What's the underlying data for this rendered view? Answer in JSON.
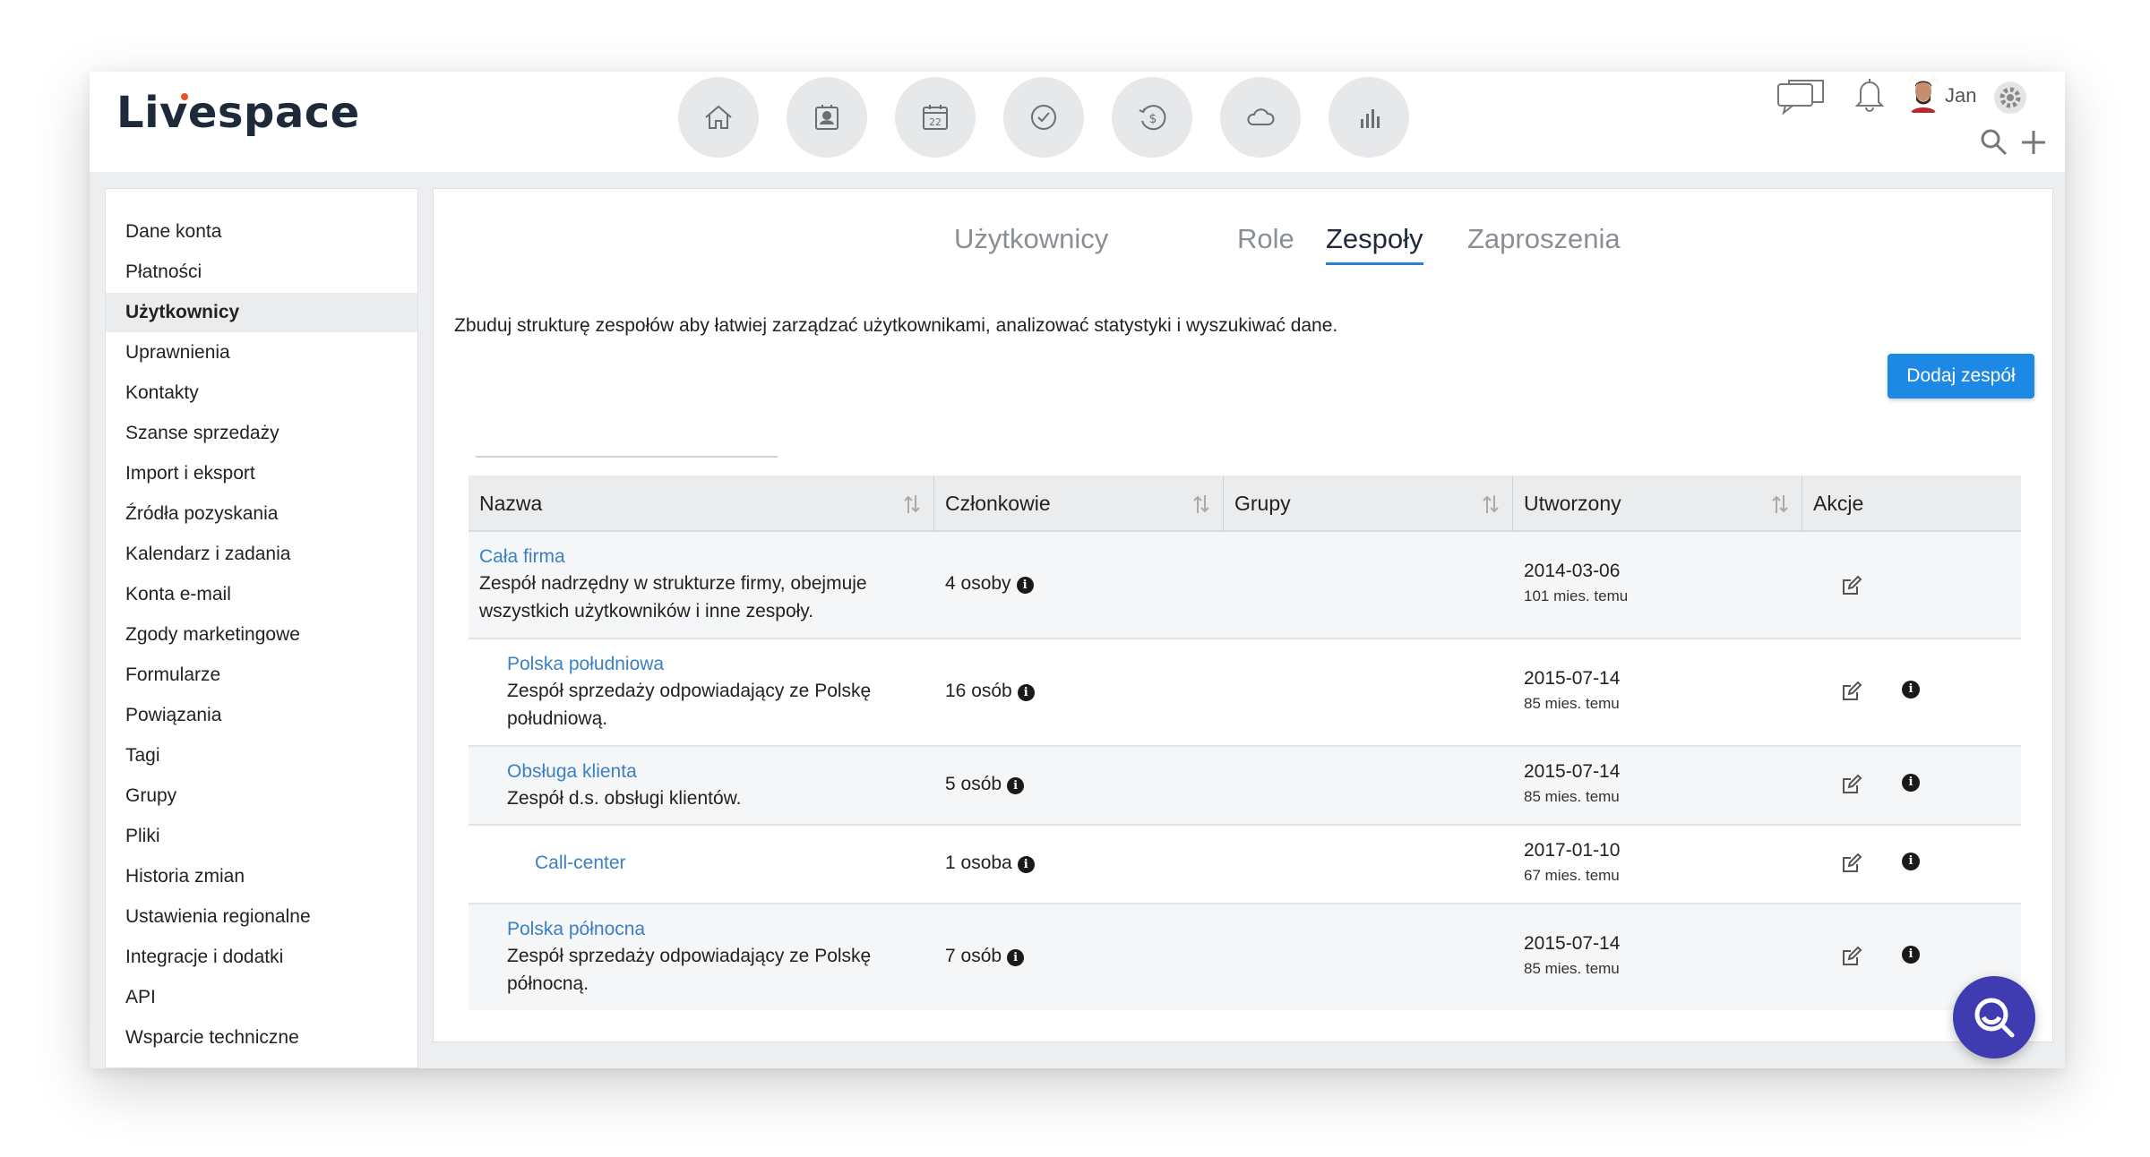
{
  "app": {
    "logo_text": "Livespace"
  },
  "nav": {
    "items": [
      "home-icon",
      "contacts-icon",
      "calendar-icon",
      "tasks-icon",
      "deals-icon",
      "cloud-icon",
      "reports-icon"
    ],
    "calendar_day": "22"
  },
  "user": {
    "name": "Jan"
  },
  "sidebar": {
    "items": [
      {
        "label": "Dane konta"
      },
      {
        "label": "Płatności"
      },
      {
        "label": "Użytkownicy"
      },
      {
        "label": "Uprawnienia"
      },
      {
        "label": "Kontakty"
      },
      {
        "label": "Szanse sprzedaży"
      },
      {
        "label": "Import i eksport"
      },
      {
        "label": "Źródła pozyskania"
      },
      {
        "label": "Kalendarz i zadania"
      },
      {
        "label": "Konta e-mail"
      },
      {
        "label": "Zgody marketingowe"
      },
      {
        "label": "Formularze"
      },
      {
        "label": "Powiązania"
      },
      {
        "label": "Tagi"
      },
      {
        "label": "Grupy"
      },
      {
        "label": "Pliki"
      },
      {
        "label": "Historia zmian"
      },
      {
        "label": "Ustawienia regionalne"
      },
      {
        "label": "Integracje i dodatki"
      },
      {
        "label": "API"
      },
      {
        "label": "Wsparcie techniczne"
      }
    ],
    "active": "Użytkownicy"
  },
  "tabs": {
    "items": [
      {
        "label": "Użytkownicy"
      },
      {
        "label": "Role"
      },
      {
        "label": "Zespoły"
      },
      {
        "label": "Zaproszenia"
      }
    ],
    "active": "Zespoły"
  },
  "intro_text": "Zbuduj strukturę zespołów aby łatwiej zarządzać użytkownikami, analizować statystyki i wyszukiwać dane.",
  "add_team_label": "Dodaj zespół",
  "table": {
    "headers": [
      "Nazwa",
      "Członkowie",
      "Grupy",
      "Utworzony",
      "Akcje"
    ],
    "rows": [
      {
        "name": "Cała firma",
        "desc1": "Zespół nadrzędny w strukturze firmy, obejmuje",
        "desc2": "wszystkich użytkowników i inne zespoły.",
        "members": "4 osoby",
        "groups": "",
        "date": "2014-03-06",
        "ago": "101 mies. temu",
        "level": 0
      },
      {
        "name": "Polska południowa",
        "desc1": "Zespół sprzedaży odpowiadający ze Polskę",
        "desc2": "południową.",
        "members": "16 osób",
        "groups": "",
        "date": "2015-07-14",
        "ago": "85 mies. temu",
        "level": 1
      },
      {
        "name": "Obsługa klienta",
        "desc1": "Zespół d.s. obsługi klientów.",
        "desc2": "",
        "members": "5 osób",
        "groups": "",
        "date": "2015-07-14",
        "ago": "85 mies. temu",
        "level": 1
      },
      {
        "name": "Call-center",
        "desc1": "",
        "desc2": "",
        "members": "1 osoba",
        "groups": "",
        "date": "2017-01-10",
        "ago": "67 mies. temu",
        "level": 2
      },
      {
        "name": "Polska północna",
        "desc1": "Zespół sprzedaży odpowiadający ze Polskę",
        "desc2": "północną.",
        "members": "7 osób",
        "groups": "",
        "date": "2015-07-14",
        "ago": "85 mies. temu",
        "level": 1
      }
    ]
  },
  "colors": {
    "accent": "#1e88e5",
    "link": "#3b7fc4",
    "fab": "#3f3bb0",
    "logo_dot": "#e8512a"
  }
}
